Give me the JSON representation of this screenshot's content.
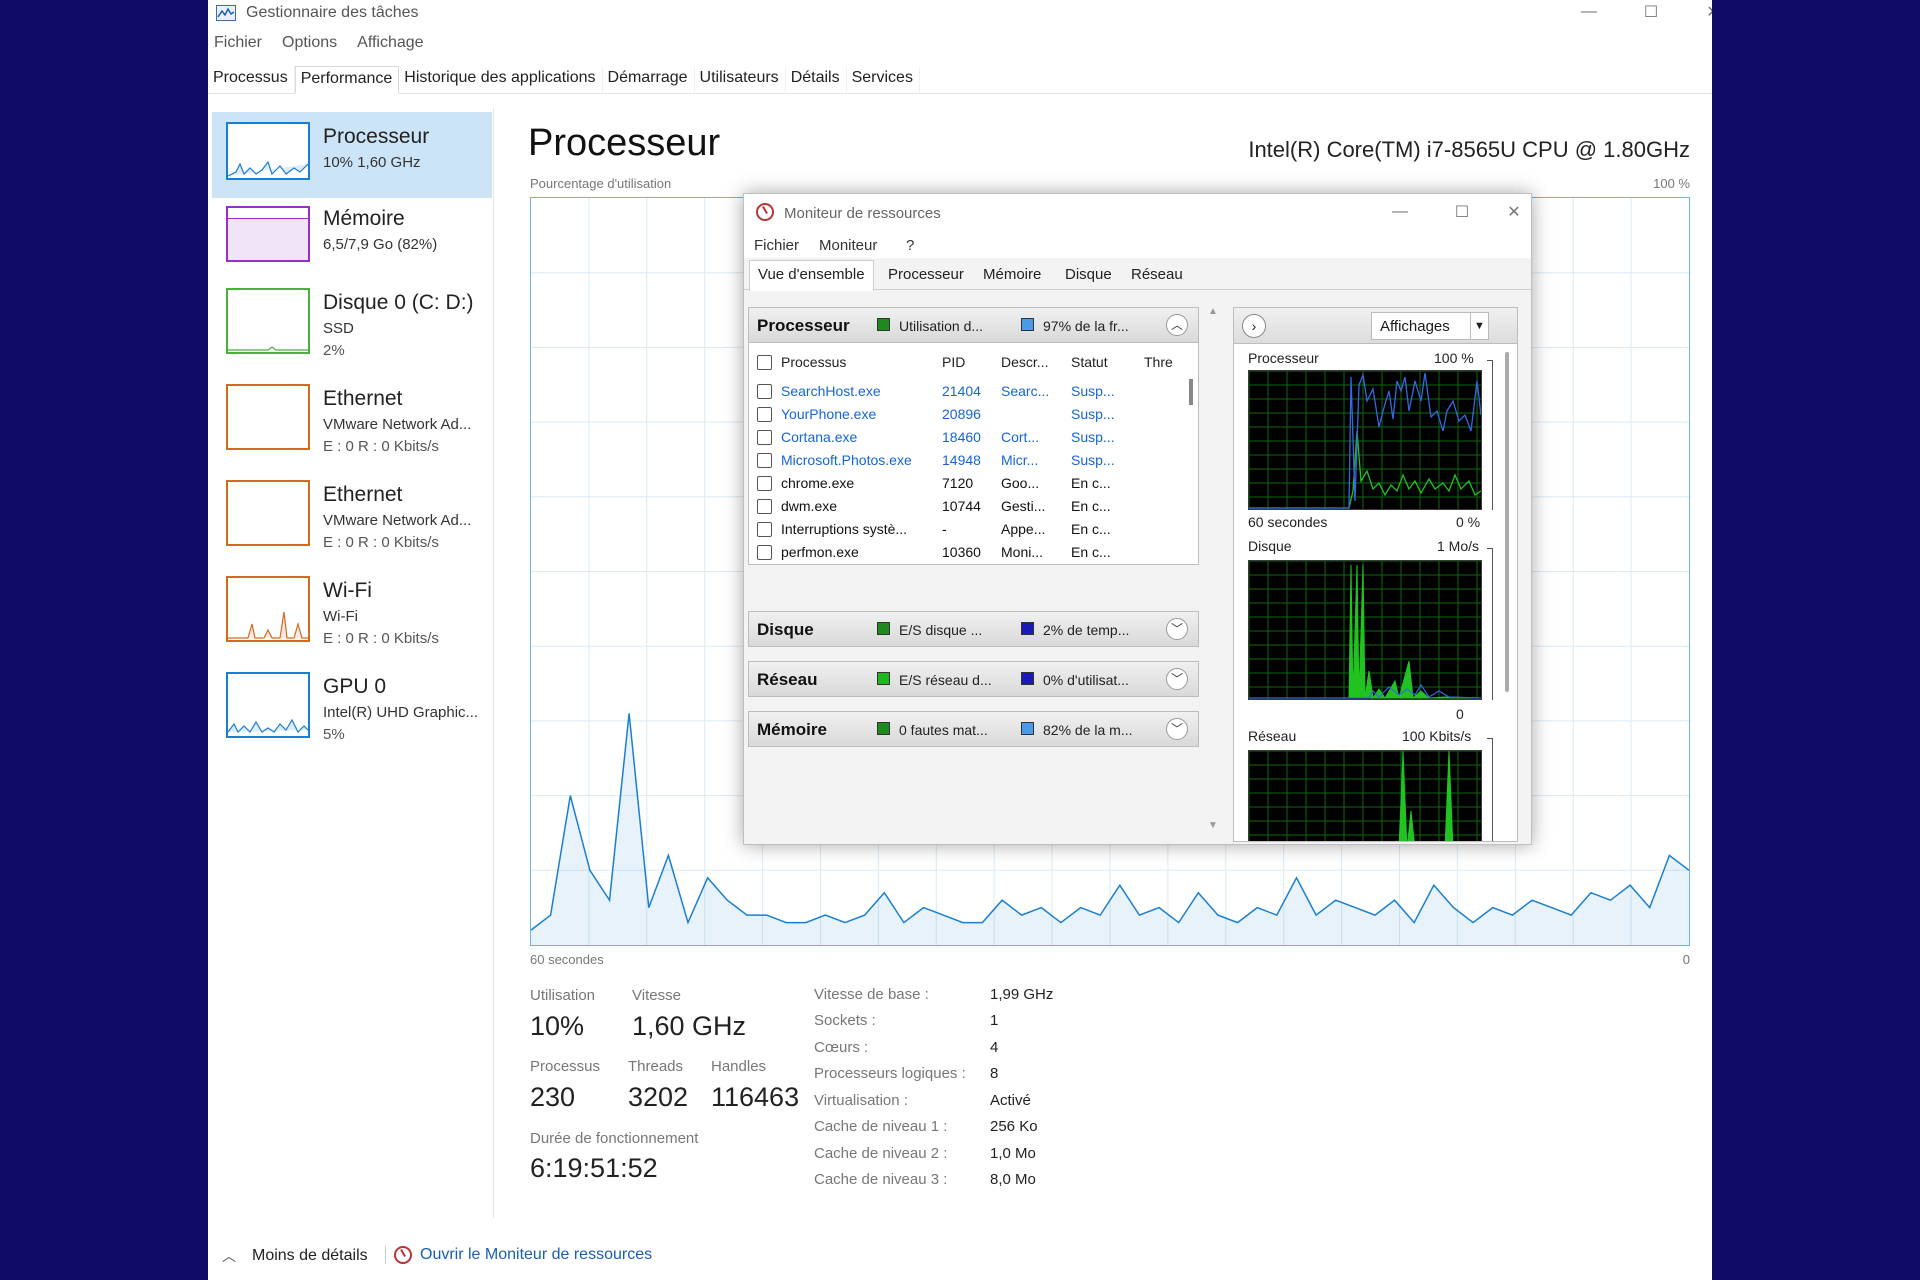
{
  "task_manager": {
    "window_title": "Gestionnaire des tâches",
    "menu": [
      "Fichier",
      "Options",
      "Affichage"
    ],
    "tabs": [
      "Processus",
      "Performance",
      "Historique des applications",
      "Démarrage",
      "Utilisateurs",
      "Détails",
      "Services"
    ],
    "active_tab": "Performance",
    "sidebar": [
      {
        "name": "Processeur",
        "sub1": "10% 1,60 GHz",
        "sub2": "",
        "color": "#1a7fd1",
        "selected": true
      },
      {
        "name": "Mémoire",
        "sub1": "6,5/7,9 Go (82%)",
        "sub2": "",
        "color": "#9b2fc5",
        "selected": false
      },
      {
        "name": "Disque 0 (C: D:)",
        "sub1": "SSD",
        "sub2": "2%",
        "color": "#4caf3d",
        "selected": false
      },
      {
        "name": "Ethernet",
        "sub1": "VMware Network Ad...",
        "sub2": "E : 0 R : 0 Kbits/s",
        "color": "#d46a1f",
        "selected": false
      },
      {
        "name": "Ethernet",
        "sub1": "VMware Network Ad...",
        "sub2": "E : 0 R : 0 Kbits/s",
        "color": "#d46a1f",
        "selected": false
      },
      {
        "name": "Wi-Fi",
        "sub1": "Wi-Fi",
        "sub2": "E : 0 R : 0 Kbits/s",
        "color": "#d46a1f",
        "selected": false
      },
      {
        "name": "GPU 0",
        "sub1": "Intel(R) UHD Graphic...",
        "sub2": "5%",
        "color": "#1a7fd1",
        "selected": false
      }
    ],
    "main": {
      "title": "Processeur",
      "cpu_model": "Intel(R) Core(TM) i7-8565U CPU @ 1.80GHz",
      "util_label": "Pourcentage d'utilisation",
      "util_max": "100 %",
      "axis_left": "60 secondes",
      "axis_right": "0",
      "graph_color": "#1a7fd1",
      "graph_values": [
        2,
        4,
        20,
        10,
        6,
        31,
        5,
        12,
        3,
        9,
        6,
        4,
        4,
        3,
        3,
        4,
        3,
        4,
        7,
        3,
        5,
        4,
        3,
        3,
        6,
        4,
        5,
        3,
        5,
        4,
        8,
        4,
        5,
        3,
        7,
        4,
        3,
        5,
        4,
        9,
        4,
        6,
        5,
        4,
        6,
        3,
        8,
        5,
        3,
        5,
        4,
        6,
        5,
        4,
        7,
        6,
        8,
        5,
        12,
        10
      ]
    },
    "stats": {
      "utilisation_label": "Utilisation",
      "utilisation_value": "10%",
      "vitesse_label": "Vitesse",
      "vitesse_value": "1,60 GHz",
      "processus_label": "Processus",
      "processus_value": "230",
      "threads_label": "Threads",
      "threads_value": "3202",
      "handles_label": "Handles",
      "handles_value": "116463",
      "uptime_label": "Durée de fonctionnement",
      "uptime_value": "6:19:51:52"
    },
    "specs": [
      {
        "label": "Vitesse de base :",
        "value": "1,99 GHz"
      },
      {
        "label": "Sockets :",
        "value": "1"
      },
      {
        "label": "Cœurs :",
        "value": "4"
      },
      {
        "label": "Processeurs logiques :",
        "value": "8"
      },
      {
        "label": "Virtualisation :",
        "value": "Activé"
      },
      {
        "label": "Cache de niveau 1 :",
        "value": "256 Ko"
      },
      {
        "label": "Cache de niveau 2 :",
        "value": "1,0 Mo"
      },
      {
        "label": "Cache de niveau 3 :",
        "value": "8,0 Mo"
      }
    ],
    "footer": {
      "less_details": "Moins de détails",
      "open_monitor": "Ouvrir le Moniteur de ressources"
    }
  },
  "resource_monitor": {
    "window_title": "Moniteur de ressources",
    "menu": [
      "Fichier",
      "Moniteur",
      "?"
    ],
    "tabs": [
      "Vue d'ensemble",
      "Processeur",
      "Mémoire",
      "Disque",
      "Réseau"
    ],
    "active_tab": "Vue d'ensemble",
    "sections": [
      {
        "name": "Processeur",
        "t1": "Utilisation d...",
        "t2": "97% de la fr...",
        "c1": "#1e8a1e",
        "c2": "#4a9ae8",
        "expanded": true
      },
      {
        "name": "Disque",
        "t1": "E/S disque ...",
        "t2": "2% de temp...",
        "c1": "#1e8a1e",
        "c2": "#1a1ab8",
        "expanded": false
      },
      {
        "name": "Réseau",
        "t1": "E/S réseau d...",
        "t2": "0% d'utilisat...",
        "c1": "#1eb81e",
        "c2": "#1a1ab8",
        "expanded": false
      },
      {
        "name": "Mémoire",
        "t1": "0 fautes mat...",
        "t2": "82% de la m...",
        "c1": "#1e8a1e",
        "c2": "#4a9ae8",
        "expanded": false
      }
    ],
    "process_table": {
      "headers": [
        "Processus",
        "PID",
        "Descr...",
        "Statut",
        "Thre"
      ],
      "rows": [
        {
          "name": "SearchHost.exe",
          "pid": "21404",
          "desc": "Searc...",
          "status": "Susp...",
          "suspended": true
        },
        {
          "name": "YourPhone.exe",
          "pid": "20896",
          "desc": "",
          "status": "Susp...",
          "suspended": true
        },
        {
          "name": "Cortana.exe",
          "pid": "18460",
          "desc": "Cort...",
          "status": "Susp...",
          "suspended": true
        },
        {
          "name": "Microsoft.Photos.exe",
          "pid": "14948",
          "desc": "Micr...",
          "status": "Susp...",
          "suspended": true
        },
        {
          "name": "chrome.exe",
          "pid": "7120",
          "desc": "Goo...",
          "status": "En c...",
          "suspended": false
        },
        {
          "name": "dwm.exe",
          "pid": "10744",
          "desc": "Gesti...",
          "status": "En c...",
          "suspended": false
        },
        {
          "name": "Interruptions systè...",
          "pid": "-",
          "desc": "Appe...",
          "status": "En c...",
          "suspended": false
        },
        {
          "name": "perfmon.exe",
          "pid": "10360",
          "desc": "Moni...",
          "status": "En c...",
          "suspended": false
        }
      ]
    },
    "right_panel": {
      "views_label": "Affichages",
      "graphs": [
        {
          "title": "Processeur",
          "max": "100 %",
          "min_left": "60 secondes",
          "min_right": "0 %"
        },
        {
          "title": "Disque",
          "max": "1 Mo/s",
          "min_left": "",
          "min_right": "0"
        },
        {
          "title": "Réseau",
          "max": "100 Kbits/s",
          "min_left": "",
          "min_right": ""
        }
      ]
    }
  }
}
